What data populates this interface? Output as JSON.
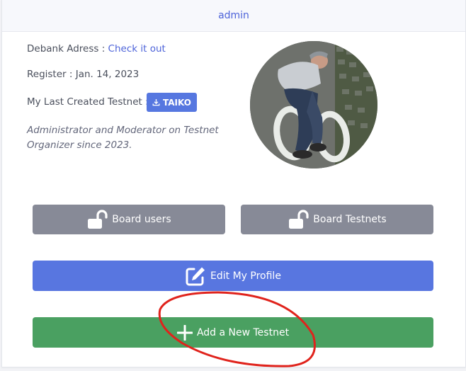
{
  "header": {
    "title": "admin"
  },
  "profile": {
    "debank_label": "Debank Adress : ",
    "debank_link": "Check it out",
    "register": "Register : Jan. 14, 2023",
    "last_testnet_label": "My Last Created Testnet : ",
    "last_testnet_badge": "TAIKO",
    "bio": "Administrator and Moderator on Testnet Organizer since 2023."
  },
  "buttons": {
    "board_users": "Board users",
    "board_testnets": "Board Testnets",
    "edit_profile": "Edit My Profile",
    "add_testnet": "Add a New Testnet"
  },
  "icons": {
    "badge": "download-icon",
    "board_users": "unlock-icon",
    "board_testnets": "unlock-icon",
    "edit_profile": "edit-icon",
    "add_testnet": "plus-icon"
  },
  "colors": {
    "accent": "#4d63d9",
    "gray_button": "#878a97",
    "blue_button": "#5876e0",
    "green_button": "#4aa061",
    "annotation": "#e0231c"
  }
}
